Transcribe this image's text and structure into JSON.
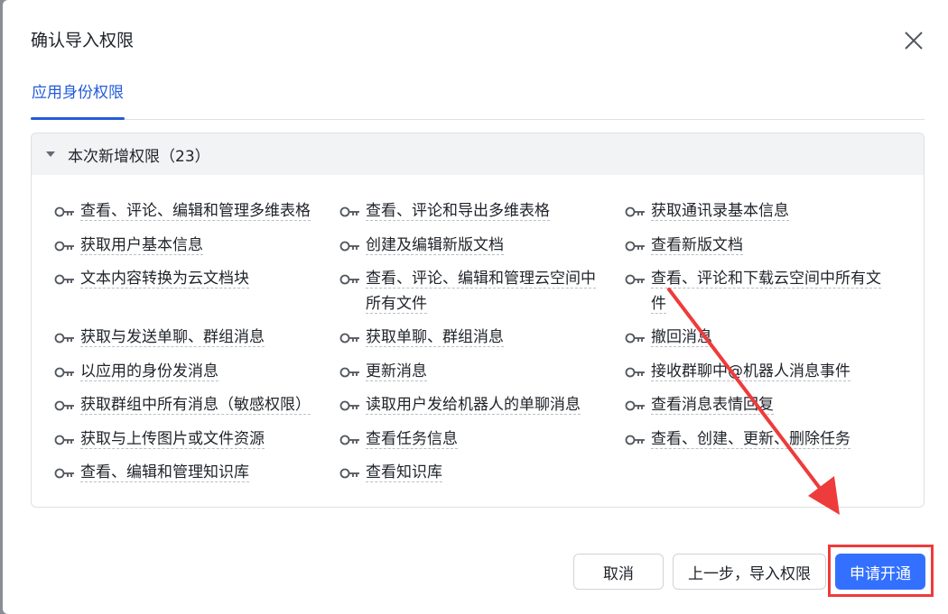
{
  "dialog": {
    "title": "确认导入权限",
    "tab_label": "应用身份权限",
    "panel_title": "本次新增权限（23）",
    "permissions": [
      "查看、评论、编辑和管理多维表格",
      "查看、评论和导出多维表格",
      "获取通讯录基本信息",
      "获取用户基本信息",
      "创建及编辑新版文档",
      "查看新版文档",
      "文本内容转换为云文档块",
      "查看、评论、编辑和管理云空间中所有文件",
      "查看、评论和下载云空间中所有文件",
      "获取与发送单聊、群组消息",
      "获取单聊、群组消息",
      "撤回消息",
      "以应用的身份发消息",
      "更新消息",
      "接收群聊中@机器人消息事件",
      "获取群组中所有消息（敏感权限）",
      "读取用户发给机器人的单聊消息",
      "查看消息表情回复",
      "获取与上传图片或文件资源",
      "查看任务信息",
      "查看、创建、更新、删除任务",
      "查看、编辑和管理知识库",
      "查看知识库"
    ],
    "buttons": {
      "cancel": "取消",
      "prev": "上一步，导入权限",
      "apply": "申请开通"
    }
  },
  "colors": {
    "accent": "#3370ff",
    "tab_active": "#245bdb",
    "annotation_red": "#ee3b3b"
  },
  "icons": {
    "close": "close-icon",
    "caret": "caret-down-icon",
    "permission": "key-icon"
  }
}
